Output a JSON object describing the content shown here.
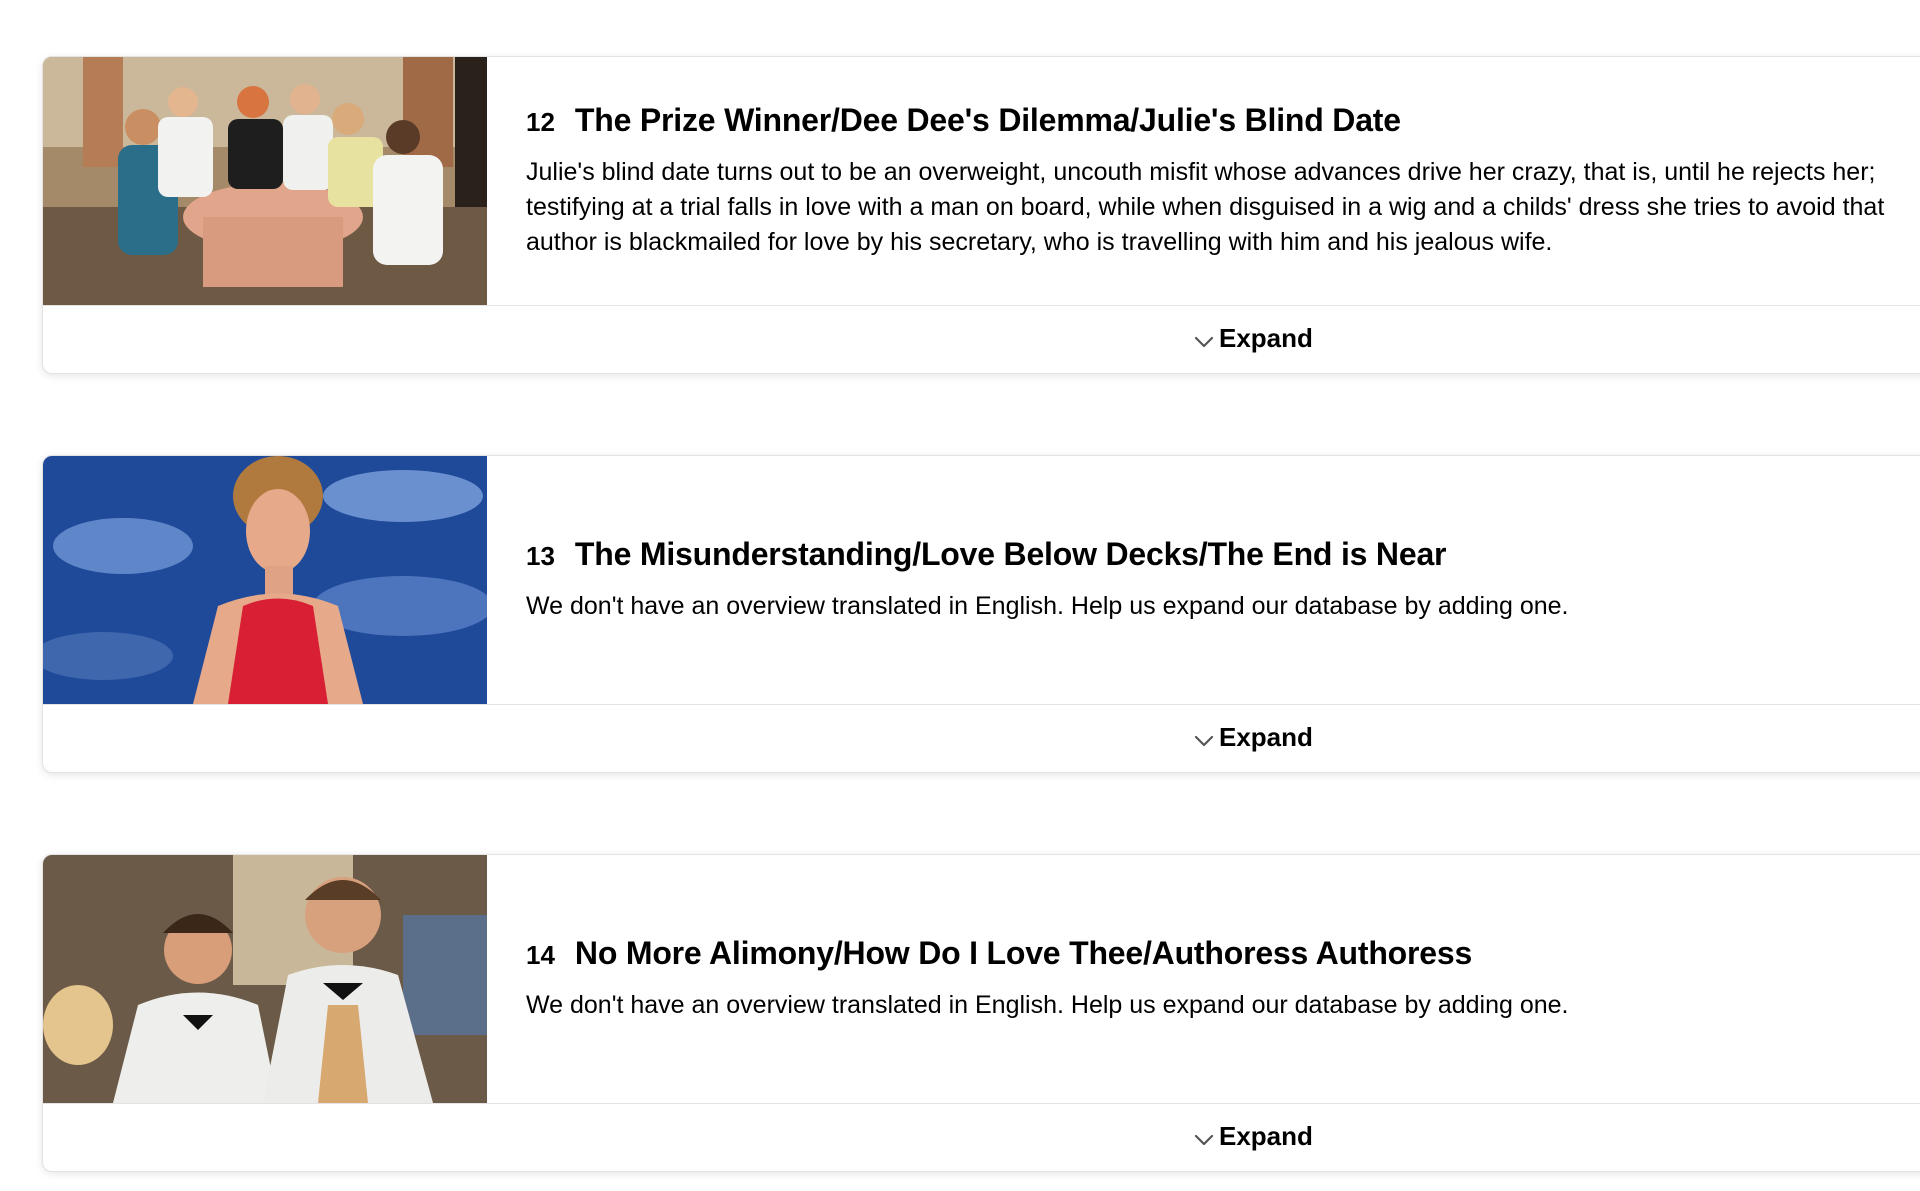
{
  "episodes": [
    {
      "number": "12",
      "title": "The Prize Winner/Dee Dee's Dilemma/Julie's Blind Date",
      "overview": "Julie's blind date turns out to be an overweight, uncouth misfit whose advances drive her crazy, that is, until he rejects her;\ntestifying at a trial falls in love with a man on board, while when disguised in a wig and a childs' dress she tries to avoid that\nauthor is blackmailed for love by his secretary, who is travelling with him and his jealous wife.",
      "expand_label": "Expand",
      "still_icon": "dining-table-scene-image"
    },
    {
      "number": "13",
      "title": "The Misunderstanding/Love Below Decks/The End is Near",
      "overview": "We don't have an overview translated in English. Help us expand our database by adding one.",
      "expand_label": "Expand",
      "still_icon": "woman-red-dress-sky-image"
    },
    {
      "number": "14",
      "title": "No More Alimony/How Do I Love Thee/Authoress Authoress",
      "overview": "We don't have an overview translated in English. Help us expand our database by adding one.",
      "expand_label": "Expand",
      "still_icon": "two-officers-image"
    }
  ],
  "colors": {
    "card_border": "#e3e3e3",
    "text": "#000000",
    "background": "#ffffff"
  }
}
